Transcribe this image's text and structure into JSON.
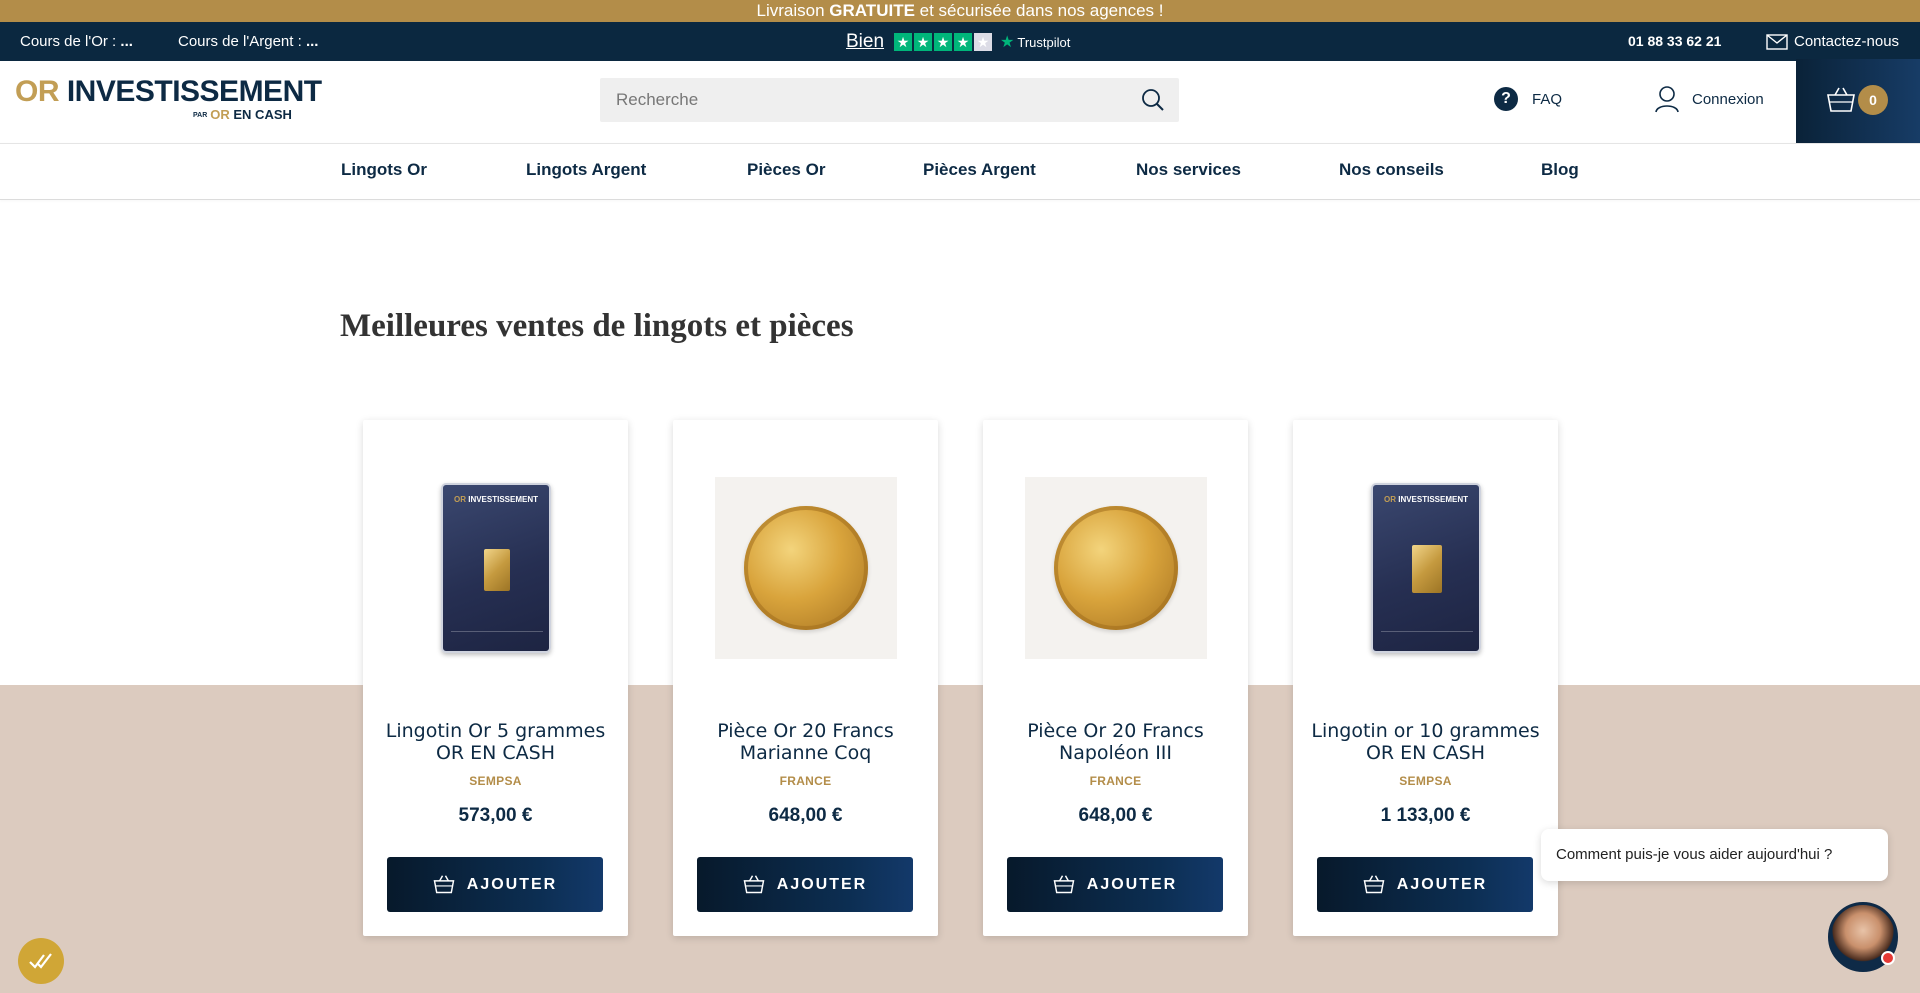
{
  "promo": {
    "pre": "Livraison",
    "bold": "GRATUITE",
    "post": "et sécurisée dans nos agences !"
  },
  "infobar": {
    "gold_rate_label": "Cours de l'Or :",
    "gold_rate_value": "...",
    "silver_rate_label": "Cours de l'Argent :",
    "silver_rate_value": "...",
    "trustpilot_word": "Bien",
    "trustpilot_stars": 4,
    "trustpilot_brand": "Trustpilot",
    "phone": "01 88 33 62 21",
    "contact": "Contactez-nous"
  },
  "header": {
    "logo_or": "OR",
    "logo_main": "INVESTISSEMENT",
    "logo_par": "PAR",
    "logo_sub_or": "OR",
    "logo_sub": "EN CASH",
    "search_placeholder": "Recherche",
    "faq": "FAQ",
    "login": "Connexion",
    "cart_count": "0"
  },
  "nav": [
    "Lingots Or",
    "Lingots Argent",
    "Pièces Or",
    "Pièces Argent",
    "Nos services",
    "Nos conseils",
    "Blog"
  ],
  "section_title": "Meilleures ventes de lingots et pièces",
  "products": [
    {
      "name": "Lingotin Or 5 grammes OR EN CASH",
      "brand": "SEMPSA",
      "price": "573,00 €",
      "button": "AJOUTER",
      "kind": "bar"
    },
    {
      "name": "Pièce Or 20 Francs Marianne Coq",
      "brand": "FRANCE",
      "price": "648,00 €",
      "button": "AJOUTER",
      "kind": "coin"
    },
    {
      "name": "Pièce Or 20 Francs Napoléon III",
      "brand": "FRANCE",
      "price": "648,00 €",
      "button": "AJOUTER",
      "kind": "coin"
    },
    {
      "name": "Lingotin or 10 grammes OR EN CASH",
      "brand": "SEMPSA",
      "price": "1 133,00 €",
      "button": "AJOUTER",
      "kind": "bar"
    }
  ],
  "bar_box": {
    "or": "OR",
    "main": "INVESTISSEMENT"
  },
  "chat": {
    "message": "Comment puis-je vous aider aujourd'hui ?"
  },
  "colors": {
    "navy": "#0d2a44",
    "gold": "#b38d49",
    "beige": "#dccbbf",
    "trustpilot_green": "#00b67a"
  }
}
